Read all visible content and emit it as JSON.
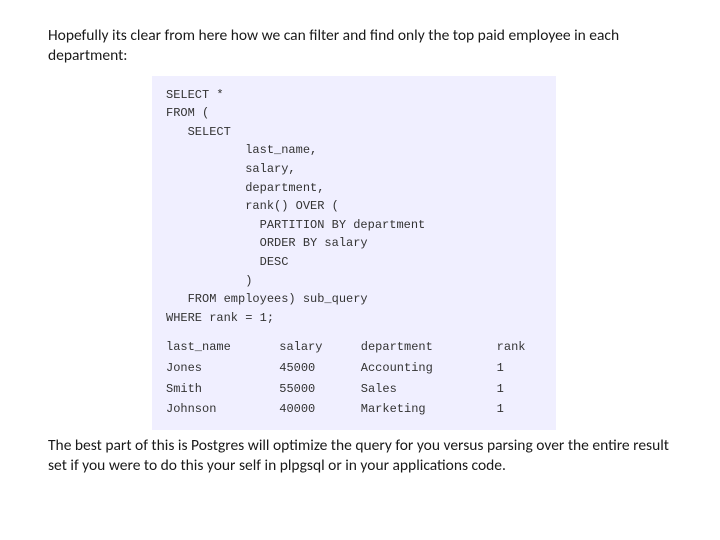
{
  "intro": "Hopefully its clear from here how we can filter and find only the top paid employee in each department:",
  "code": {
    "l1": "SELECT *",
    "l2": "FROM (",
    "l3": "   SELECT",
    "l4": "           last_name,",
    "l5": "           salary,",
    "l6": "           department,",
    "l7": "           rank() OVER (",
    "l8": "             PARTITION BY department",
    "l9": "             ORDER BY salary",
    "l10": "             DESC",
    "l11": "           )",
    "l12": "   FROM employees) sub_query",
    "l13": "WHERE rank = 1;"
  },
  "results": {
    "header": {
      "c1": "last_name",
      "c2": "salary",
      "c3": "department",
      "c4": "rank"
    },
    "rows": [
      {
        "c1": "Jones",
        "c2": "45000",
        "c3": "Accounting",
        "c4": "1"
      },
      {
        "c1": "Smith",
        "c2": "55000",
        "c3": "Sales",
        "c4": "1"
      },
      {
        "c1": "Johnson",
        "c2": "40000",
        "c3": "Marketing",
        "c4": "1"
      }
    ]
  },
  "outro": "The best part of this is Postgres will optimize the query for you versus parsing over the entire result set if you were to do this your self in plpgsql or in your applications code."
}
